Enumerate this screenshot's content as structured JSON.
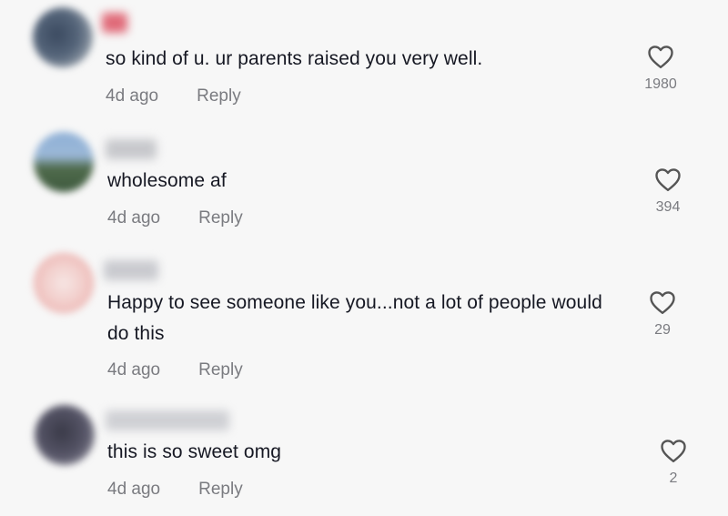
{
  "comments": [
    {
      "text": "so kind of u. ur parents raised you very well.",
      "time": "4d ago",
      "reply": "Reply",
      "likes": "1980",
      "heart_icon": "heart-outline-icon"
    },
    {
      "text": "wholesome af",
      "time": "4d ago",
      "reply": "Reply",
      "likes": "394",
      "heart_icon": "heart-outline-icon"
    },
    {
      "text": "Happy to see someone like you...not a lot of people would do this",
      "time": "4d ago",
      "reply": "Reply",
      "likes": "29",
      "heart_icon": "heart-outline-icon"
    },
    {
      "text": "this is so sweet omg",
      "time": "4d ago",
      "reply": "Reply",
      "likes": "2",
      "heart_icon": "heart-outline-icon"
    }
  ],
  "colors": {
    "background": "#f7f7f7",
    "text": "#161823",
    "secondary_text": "#7a7b80",
    "heart_stroke": "#555555"
  }
}
